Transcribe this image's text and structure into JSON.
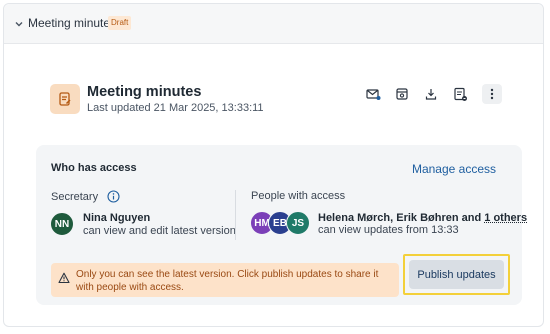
{
  "section": {
    "title": "Meeting minutes",
    "badge": "Draft"
  },
  "document": {
    "title": "Meeting minutes",
    "updated": "Last updated 21 Mar 2025, 13:33:11",
    "toolbar_icons": [
      "email-icon",
      "present-icon",
      "download-icon",
      "export-icon",
      "more-icon"
    ]
  },
  "access": {
    "heading": "Who has access",
    "manage_label": "Manage access",
    "secretary": {
      "label": "Secretary",
      "avatar": "NN",
      "avatar_color": "#1e5a3c",
      "name": "Nina Nguyen",
      "permission": "can view and edit latest version"
    },
    "people": {
      "label": "People with access",
      "avatars": [
        {
          "initials": "HM",
          "color": "#7b3fb8"
        },
        {
          "initials": "EB",
          "color": "#2a3f8f"
        },
        {
          "initials": "JS",
          "color": "#1f7a68"
        }
      ],
      "names": "Helena Mørch, Erik Bøhren and ",
      "others": "1 others",
      "permission": "can view updates from 13:33"
    },
    "warning": "Only you can see the latest version. Click publish updates to share it with people with access.",
    "publish_label": "Publish updates"
  },
  "colors": {
    "accent": "#1f5fa0",
    "warning_bg": "#fde2c9",
    "highlight": "#f3d03a",
    "doc_icon_bg": "#f9dcc0"
  }
}
